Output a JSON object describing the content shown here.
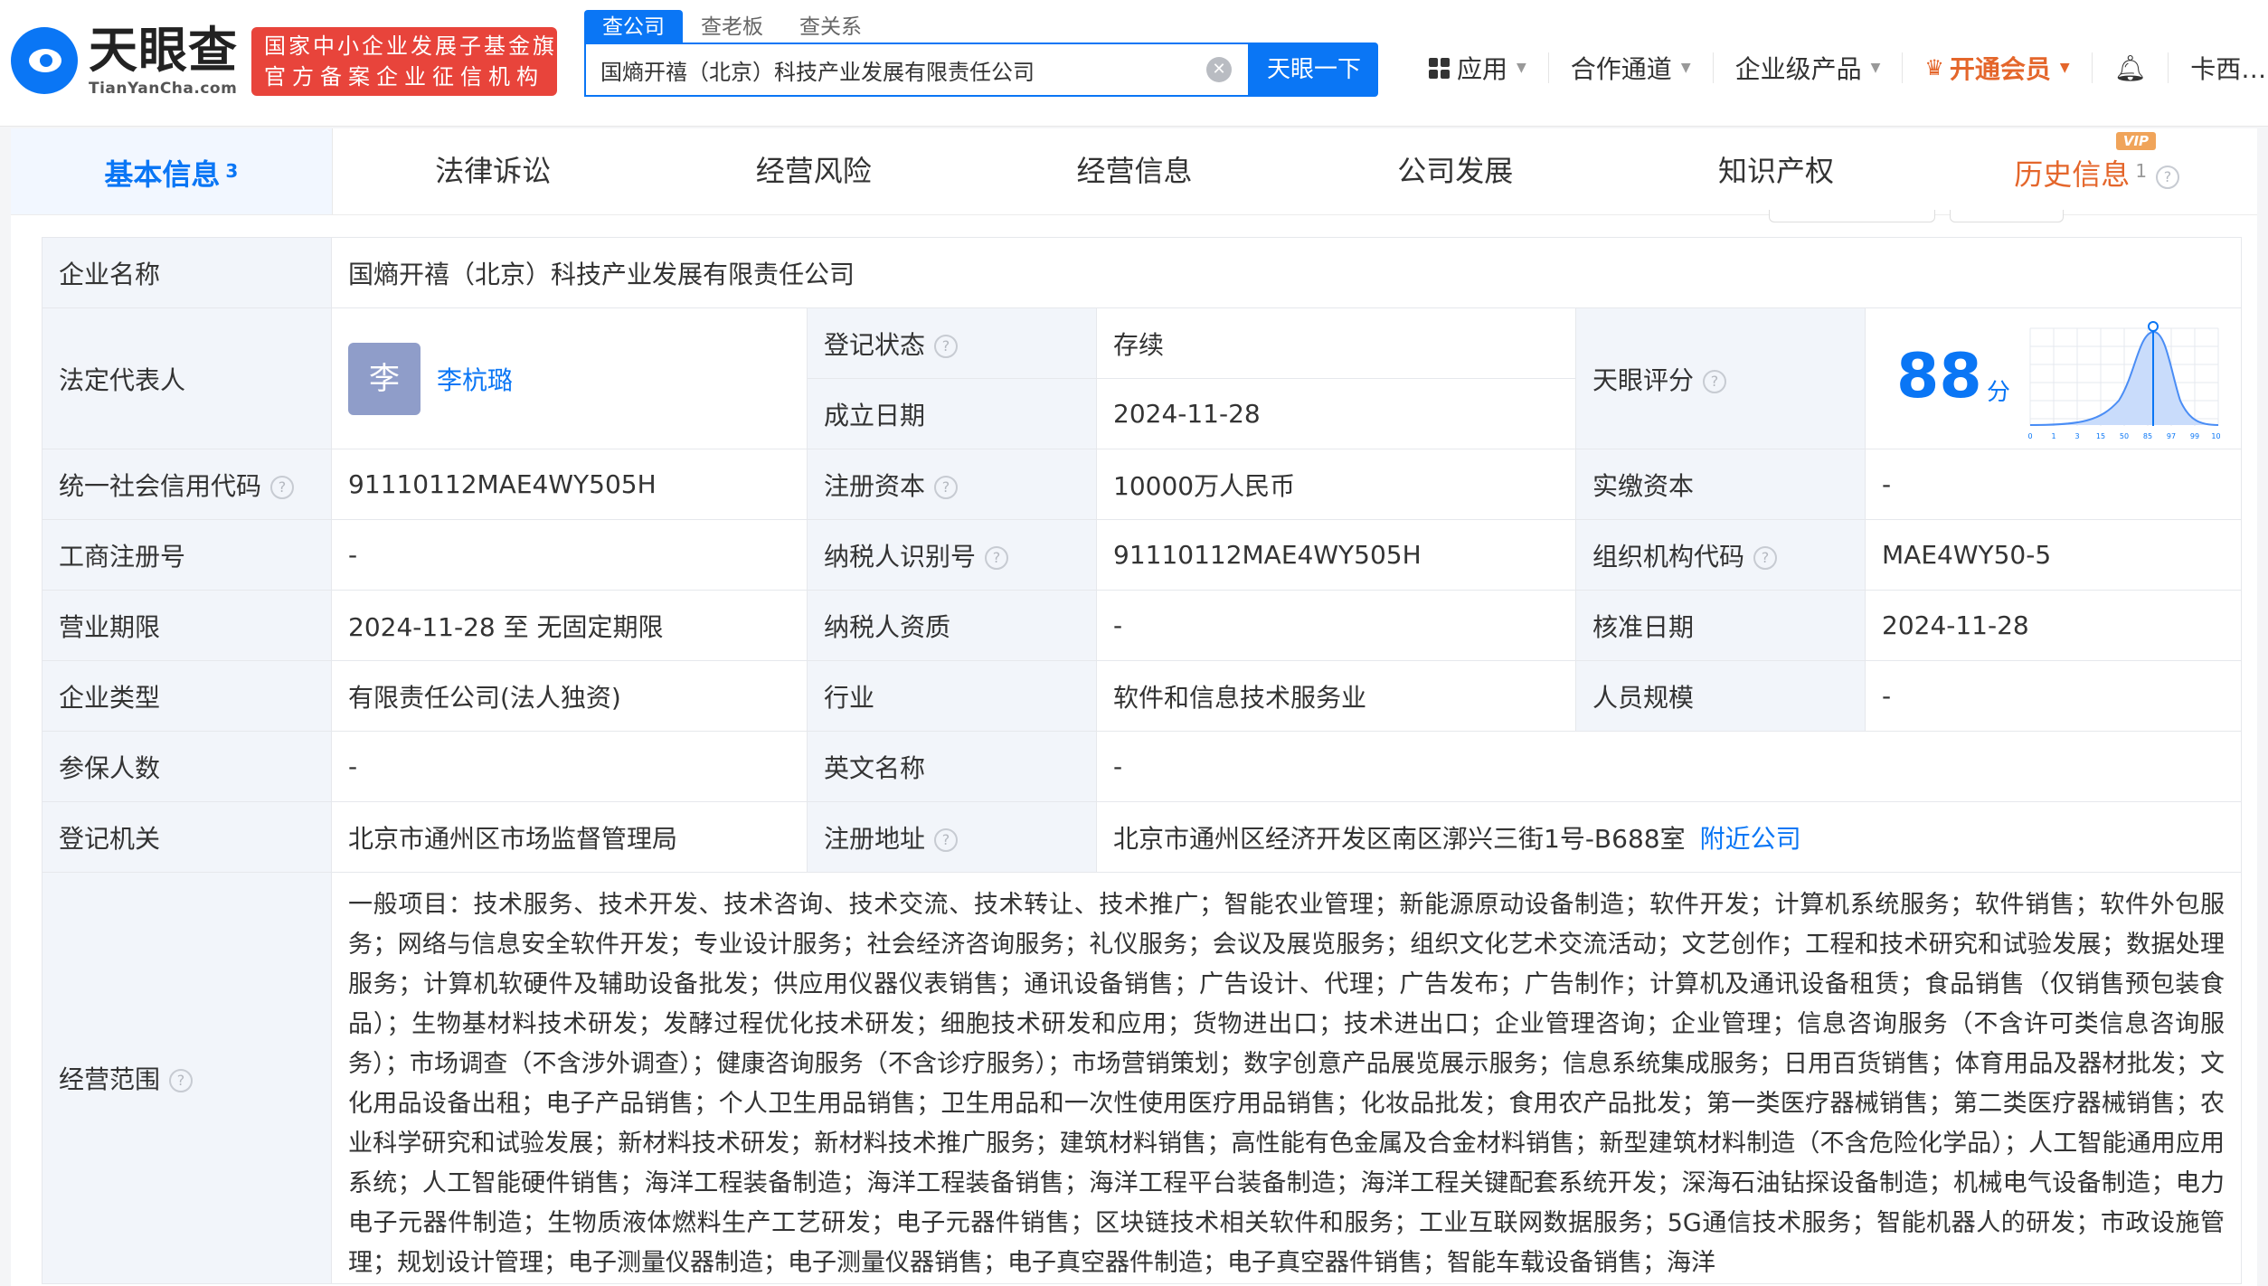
{
  "header": {
    "logo_text": "天眼查",
    "logo_sub": "TianYanCha.com",
    "badge_line1": "国家中小企业发展子基金旗下",
    "badge_line2": "官方备案企业征信机构",
    "search_tabs": [
      "查公司",
      "查老板",
      "查关系"
    ],
    "search_value": "国熵开禧（北京）科技产业发展有限责任公司",
    "search_button": "天眼一下",
    "nav": {
      "apps": "应用",
      "channel": "合作通道",
      "enterprise": "企业级产品",
      "vip": "开通会员",
      "user": "卡西…"
    }
  },
  "tabs": [
    {
      "label": "基本信息",
      "count": "3"
    },
    {
      "label": "法律诉讼"
    },
    {
      "label": "经营风险"
    },
    {
      "label": "经营信息"
    },
    {
      "label": "公司发展"
    },
    {
      "label": "知识产权"
    },
    {
      "label": "历史信息",
      "count": "1",
      "vip": "VIP"
    }
  ],
  "info": {
    "company_name_label": "企业名称",
    "company_name": "国熵开禧（北京）科技产业发展有限责任公司",
    "legal_rep_label": "法定代表人",
    "legal_rep_avatar": "李",
    "legal_rep": "李杭璐",
    "reg_status_label": "登记状态",
    "reg_status": "存续",
    "found_date_label": "成立日期",
    "found_date": "2024-11-28",
    "score_label": "天眼评分",
    "score": "88",
    "score_unit": "分",
    "score_ticks": [
      "0",
      "1",
      "3",
      "15",
      "50",
      "85",
      "97",
      "99",
      "100"
    ],
    "credit_code_label": "统一社会信用代码",
    "credit_code": "91110112MAE4WY505H",
    "reg_capital_label": "注册资本",
    "reg_capital": "10000万人民币",
    "paid_capital_label": "实缴资本",
    "paid_capital": "-",
    "biz_reg_no_label": "工商注册号",
    "biz_reg_no": "-",
    "taxpayer_id_label": "纳税人识别号",
    "taxpayer_id": "91110112MAE4WY505H",
    "org_code_label": "组织机构代码",
    "org_code": "MAE4WY50-5",
    "biz_term_label": "营业期限",
    "biz_term": "2024-11-28 至 无固定期限",
    "taxpayer_qual_label": "纳税人资质",
    "taxpayer_qual": "-",
    "approve_date_label": "核准日期",
    "approve_date": "2024-11-28",
    "company_type_label": "企业类型",
    "company_type": "有限责任公司(法人独资)",
    "industry_label": "行业",
    "industry": "软件和信息技术服务业",
    "staff_size_label": "人员规模",
    "staff_size": "-",
    "insured_label": "参保人数",
    "insured": "-",
    "english_name_label": "英文名称",
    "english_name": "-",
    "reg_authority_label": "登记机关",
    "reg_authority": "北京市通州区市场监督管理局",
    "reg_address_label": "注册地址",
    "reg_address": "北京市通州区经济开发区南区漷兴三街1号-B688室",
    "nearby_link": "附近公司",
    "scope_label": "经营范围",
    "scope": "一般项目：技术服务、技术开发、技术咨询、技术交流、技术转让、技术推广；智能农业管理；新能源原动设备制造；软件开发；计算机系统服务；软件销售；软件外包服务；网络与信息安全软件开发；专业设计服务；社会经济咨询服务；礼仪服务；会议及展览服务；组织文化艺术交流活动；文艺创作；工程和技术研究和试验发展；数据处理服务；计算机软硬件及辅助设备批发；供应用仪器仪表销售；通讯设备销售；广告设计、代理；广告发布；广告制作；计算机及通讯设备租赁；食品销售（仅销售预包装食品）；生物基材料技术研发；发酵过程优化技术研发；细胞技术研发和应用；货物进出口；技术进出口；企业管理咨询；企业管理；信息咨询服务（不含许可类信息咨询服务）；市场调查（不含涉外调查）；健康咨询服务（不含诊疗服务）；市场营销策划；数字创意产品展览展示服务；信息系统集成服务；日用百货销售；体育用品及器材批发；文化用品设备出租；电子产品销售；个人卫生用品销售；卫生用品和一次性使用医疗用品销售；化妆品批发；食用农产品批发；第一类医疗器械销售；第二类医疗器械销售；农业科学研究和试验发展；新材料技术研发；新材料技术推广服务；建筑材料销售；高性能有色金属及合金材料销售；新型建筑材料制造（不含危险化学品）；人工智能通用应用系统；人工智能硬件销售；海洋工程装备制造；海洋工程装备销售；海洋工程平台装备制造；海洋工程关键配套系统开发；深海石油钻探设备制造；机械电气设备制造；电力电子元器件制造；生物质液体燃料生产工艺研发；电子元器件销售；区块链技术相关软件和服务；工业互联网数据服务；5G通信技术服务；智能机器人的研发；市政设施管理；规划设计管理；电子测量仪器制造；电子测量仪器销售；电子真空器件制造；电子真空器件销售；智能车载设备销售；海洋"
  }
}
